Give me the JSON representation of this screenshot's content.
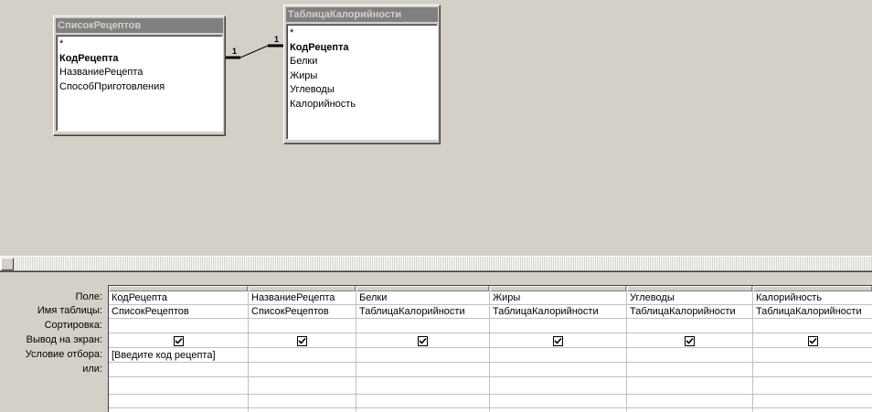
{
  "tables": [
    {
      "title": "СписокРецептов",
      "fields": [
        {
          "name": "*",
          "key": false
        },
        {
          "name": "КодРецепта",
          "key": true
        },
        {
          "name": "НазваниеРецепта",
          "key": false
        },
        {
          "name": "СпособПриготовления",
          "key": false
        }
      ]
    },
    {
      "title": "ТаблицаКалорийности",
      "fields": [
        {
          "name": "*",
          "key": false
        },
        {
          "name": "КодРецепта",
          "key": true
        },
        {
          "name": "Белки",
          "key": false
        },
        {
          "name": "Жиры",
          "key": false
        },
        {
          "name": "Углеводы",
          "key": false
        },
        {
          "name": "Калорийность",
          "key": false
        }
      ]
    }
  ],
  "relationship": {
    "left_label": "1",
    "right_label": "1"
  },
  "grid": {
    "row_labels": [
      "Поле:",
      "Имя таблицы:",
      "Сортировка:",
      "Вывод на экран:",
      "Условие отбора:",
      "или:"
    ],
    "columns": [
      {
        "field": "КодРецепта",
        "table": "СписокРецептов",
        "sort": "",
        "show": true,
        "criteria": "[Введите код рецепта]",
        "or": ""
      },
      {
        "field": "НазваниеРецепта",
        "table": "СписокРецептов",
        "sort": "",
        "show": true,
        "criteria": "",
        "or": ""
      },
      {
        "field": "Белки",
        "table": "ТаблицаКалорийности",
        "sort": "",
        "show": true,
        "criteria": "",
        "or": ""
      },
      {
        "field": "Жиры",
        "table": "ТаблицаКалорийности",
        "sort": "",
        "show": true,
        "criteria": "",
        "or": ""
      },
      {
        "field": "Углеводы",
        "table": "ТаблицаКалорийности",
        "sort": "",
        "show": true,
        "criteria": "",
        "or": ""
      },
      {
        "field": "Калорийность",
        "table": "ТаблицаКалорийности",
        "sort": "",
        "show": true,
        "criteria": "",
        "or": ""
      }
    ]
  }
}
